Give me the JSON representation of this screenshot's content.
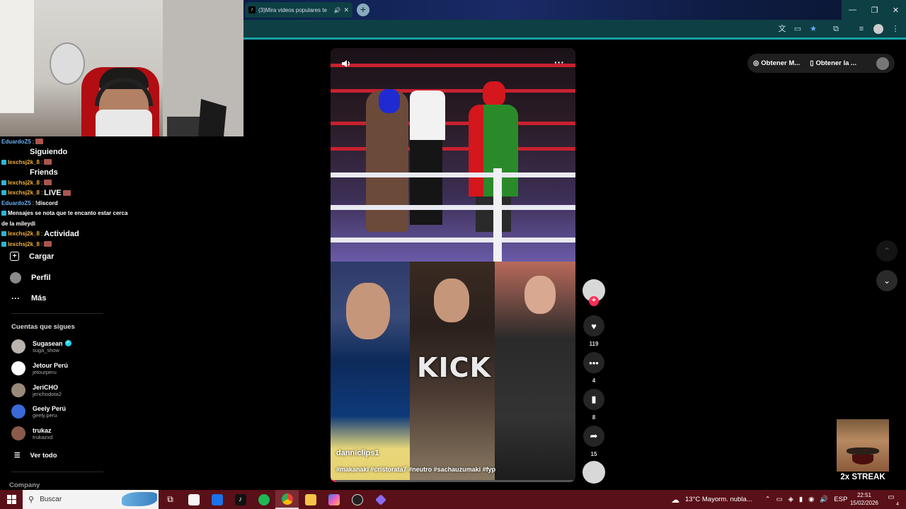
{
  "browser": {
    "tab_title": "(3)Mira videos populares te",
    "tab_favicon": "tiktok-icon",
    "new_tab": "+",
    "window_controls": [
      "—",
      "❐",
      "✕"
    ]
  },
  "chat": {
    "lines": [
      {
        "user": "EduardoZ5",
        "user_color": "blue",
        "sep": ":",
        "msg": "",
        "emote": true
      },
      {
        "user": "",
        "sep": "",
        "msg": "Siguiendo",
        "emote": false
      },
      {
        "user": "lexchsj2k_8",
        "sep": ":",
        "msg": "",
        "emote": true
      },
      {
        "user": "",
        "sep": "",
        "msg": "Friends",
        "emote": false
      },
      {
        "user": "lexchsj2k_8",
        "sep": ":",
        "msg": "",
        "emote": true
      },
      {
        "user": "lexchsj2k_8",
        "sep": ":",
        "msg": "LIVE",
        "emote": true
      },
      {
        "user": "EduardoZ5",
        "user_color": "blue",
        "sep": ":",
        "msg": "!discord",
        "emote": false
      },
      {
        "user": "",
        "sep": "",
        "msg": "Mensajes se nota que te encanto estar cerca",
        "emote": false
      },
      {
        "user": "",
        "sep": "",
        "msg": "de la mileydi",
        "emote": false
      },
      {
        "user": "lexchsj2k_8",
        "sep": ":",
        "msg": "Actividad",
        "emote": true
      },
      {
        "user": "lexchsj2k_8",
        "sep": ":",
        "msg": "",
        "emote": true
      }
    ]
  },
  "sidebar": {
    "nav": [
      {
        "label": "Cargar",
        "icon": "upload-icon",
        "glyph": "⊞"
      },
      {
        "label": "Perfil",
        "icon": "profile-avatar-icon",
        "glyph": ""
      },
      {
        "label": "Más",
        "icon": "more-icon",
        "glyph": "···"
      }
    ],
    "following_title": "Cuentas que sigues",
    "accounts": [
      {
        "name": "Sugasean",
        "handle": "suga_show",
        "verified": true,
        "color": "#b9b4b0"
      },
      {
        "name": "Jetour Perú",
        "handle": "jetourperu",
        "verified": false,
        "color": "#ffffff"
      },
      {
        "name": "JeriCHO",
        "handle": "jerichodota2",
        "verified": false,
        "color": "#9a8a7a"
      },
      {
        "name": "Geely Perú",
        "handle": "geely.peru",
        "verified": false,
        "color": "#3a6ad8"
      },
      {
        "name": "trukaz",
        "handle": "trukazxd",
        "verified": false,
        "color": "#8a5a4a"
      }
    ],
    "see_all": "Ver todo",
    "company": "Company"
  },
  "video": {
    "author": "danniclips1",
    "tags": "#makanaki #cristorata7 #neutro #sachauzumaki #fyp",
    "overlay_text": "KICK",
    "progress": 0.02
  },
  "actions": {
    "likes": "119",
    "comments": "4",
    "saves": "8",
    "shares": "15"
  },
  "topbar": {
    "get_coins": "Obtener M...",
    "get_app": "Obtener la ..."
  },
  "streak": {
    "label": "2x STREAK"
  },
  "taskbar": {
    "search_placeholder": "Buscar",
    "weather": "13°C  Mayorm. nubla...",
    "lang": "ESP",
    "time": "22:51",
    "date": "15/02/2026",
    "notifications": "4"
  },
  "colors": {
    "accent": "#fe2c55",
    "verified": "#20d5ec",
    "taskbar": "#5a1018",
    "browser_toolbar": "#0d3f44"
  }
}
